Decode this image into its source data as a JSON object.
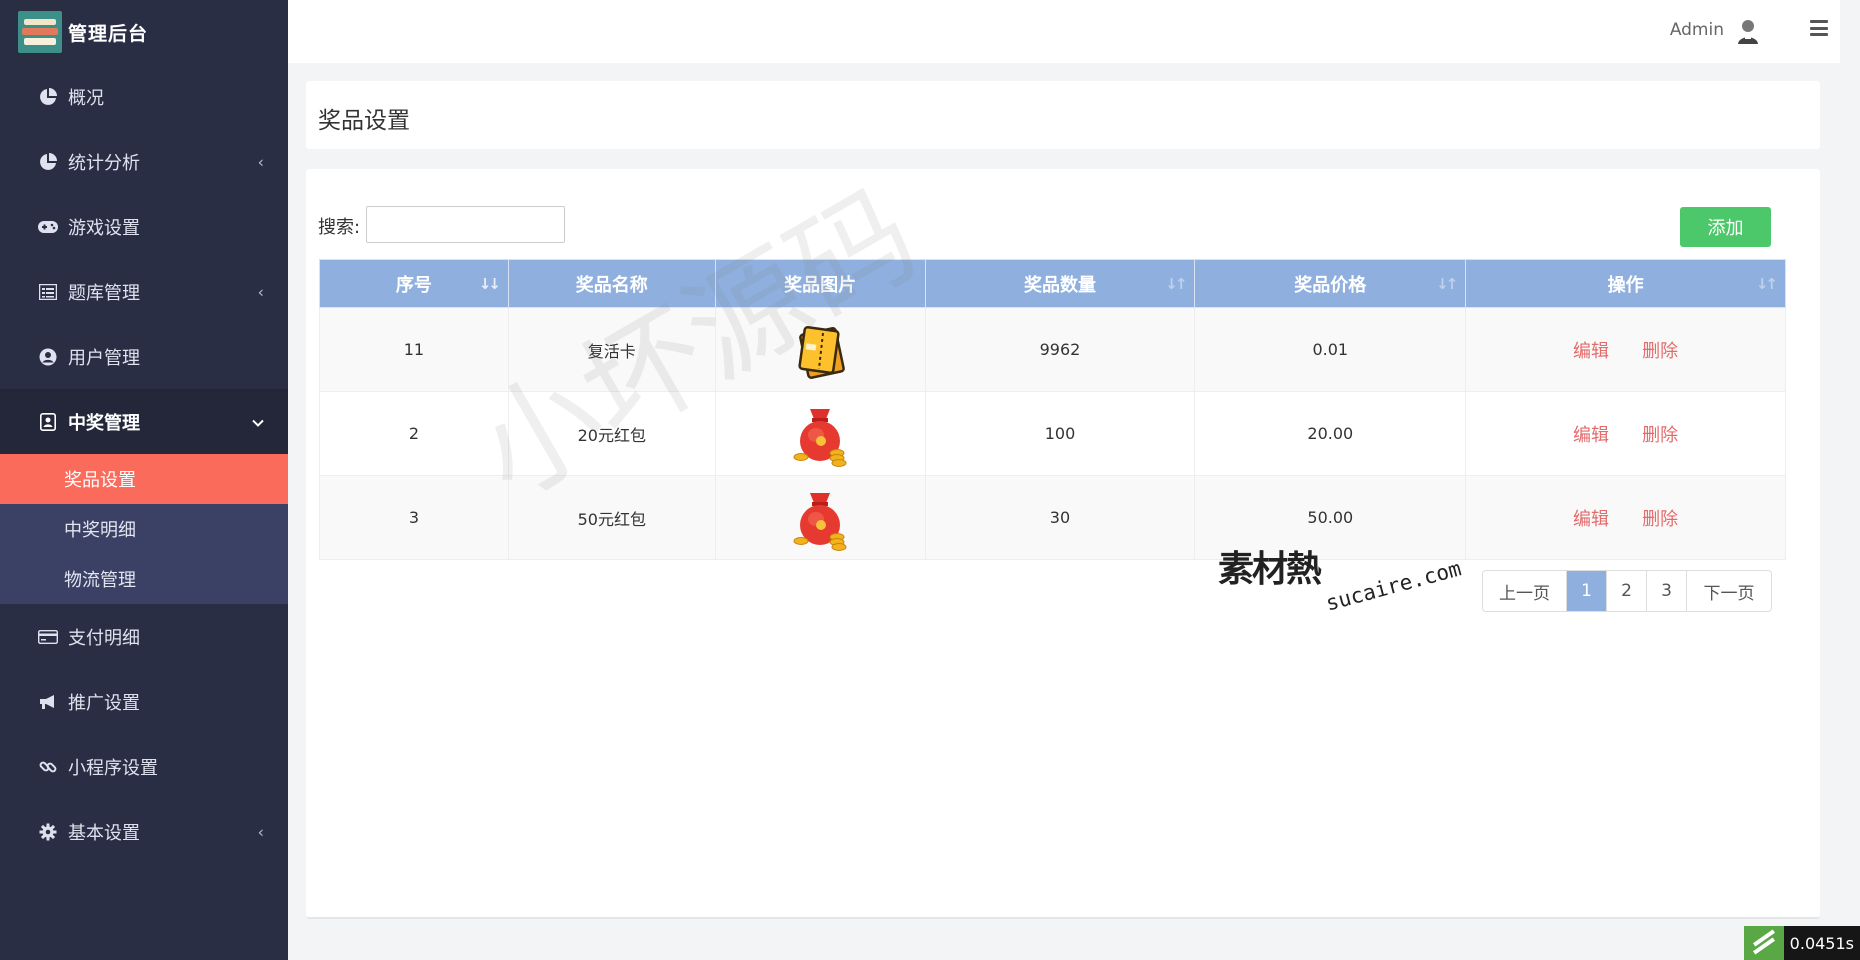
{
  "app": {
    "title": "管理后台"
  },
  "sidebar": {
    "items": [
      {
        "label": "概况",
        "icon": "pie-chart-icon",
        "chevron": ""
      },
      {
        "label": "统计分析",
        "icon": "pie-chart-icon",
        "chevron": "‹"
      },
      {
        "label": "游戏设置",
        "icon": "gamepad-icon",
        "chevron": ""
      },
      {
        "label": "题库管理",
        "icon": "list-icon",
        "chevron": "‹"
      },
      {
        "label": "用户管理",
        "icon": "user-circle-icon",
        "chevron": ""
      },
      {
        "label": "中奖管理",
        "icon": "badge-icon",
        "chevron": "⌄"
      },
      {
        "label": "支付明细",
        "icon": "credit-card-icon",
        "chevron": ""
      },
      {
        "label": "推广设置",
        "icon": "megaphone-icon",
        "chevron": ""
      },
      {
        "label": "小程序设置",
        "icon": "link-icon",
        "chevron": ""
      },
      {
        "label": "基本设置",
        "icon": "gear-icon",
        "chevron": "‹"
      }
    ],
    "submenu": [
      {
        "label": "奖品设置"
      },
      {
        "label": "中奖明细"
      },
      {
        "label": "物流管理"
      }
    ]
  },
  "topbar": {
    "user": "Admin"
  },
  "page": {
    "title": "奖品设置"
  },
  "toolbar": {
    "search_label": "搜索:",
    "search_value": "",
    "add_label": "添加"
  },
  "table": {
    "headers": [
      "序号",
      "奖品名称",
      "奖品图片",
      "奖品数量",
      "奖品价格",
      "操作"
    ],
    "rows": [
      {
        "id": "11",
        "name": "复活卡",
        "image": "ticket-card-image",
        "qty": "9962",
        "price": "0.01",
        "edit": "编辑",
        "del": "删除"
      },
      {
        "id": "2",
        "name": "20元红包",
        "image": "red-money-bag-image",
        "qty": "100",
        "price": "20.00",
        "edit": "编辑",
        "del": "删除"
      },
      {
        "id": "3",
        "name": "50元红包",
        "image": "red-money-bag-image",
        "qty": "30",
        "price": "50.00",
        "edit": "编辑",
        "del": "删除"
      }
    ]
  },
  "pagination": {
    "prev": "上一页",
    "pages": [
      "1",
      "2",
      "3"
    ],
    "current": "1",
    "next": "下一页"
  },
  "overlays": {
    "watermark": "小坏源码",
    "site_cn": "素材熱",
    "site_en": "sucaire.com",
    "timer": "0.0451s"
  },
  "colors": {
    "sidebar": "#2a2e45",
    "active": "#fb6b5b",
    "header": "#8fb0df",
    "add": "#4cc76a",
    "link": "#e46b6b"
  }
}
